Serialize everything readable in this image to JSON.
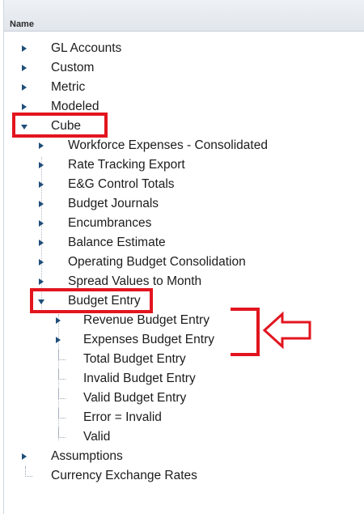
{
  "header": {
    "name_label": "Name"
  },
  "tree": {
    "gl_accounts": "GL Accounts",
    "custom": "Custom",
    "metric": "Metric",
    "modeled": "Modeled",
    "cube": "Cube",
    "cube_children": {
      "workforce": "Workforce Expenses - Consolidated",
      "rate_tracking": "Rate Tracking Export",
      "eg_control": "E&G Control Totals",
      "budget_journals": "Budget Journals",
      "encumbrances": "Encumbrances",
      "balance_estimate": "Balance Estimate",
      "operating_budget": "Operating Budget Consolidation",
      "spread_values": "Spread Values to Month",
      "budget_entry": "Budget Entry"
    },
    "budget_entry_children": {
      "revenue": "Revenue Budget Entry",
      "expenses": "Expenses Budget Entry",
      "total": "Total Budget Entry",
      "invalid": "Invalid Budget Entry",
      "valid_entry": "Valid Budget Entry",
      "error_invalid": "Error = Invalid",
      "valid": "Valid"
    },
    "assumptions": "Assumptions",
    "currency": "Currency Exchange Rates"
  },
  "colors": {
    "highlight": "#e2151f",
    "arrow": "#1f4e79",
    "header_bg": "#e6eaef"
  },
  "icons": {
    "collapsed": "caret-right-icon",
    "expanded": "caret-down-icon",
    "callout": "left-arrow-callout-icon"
  }
}
